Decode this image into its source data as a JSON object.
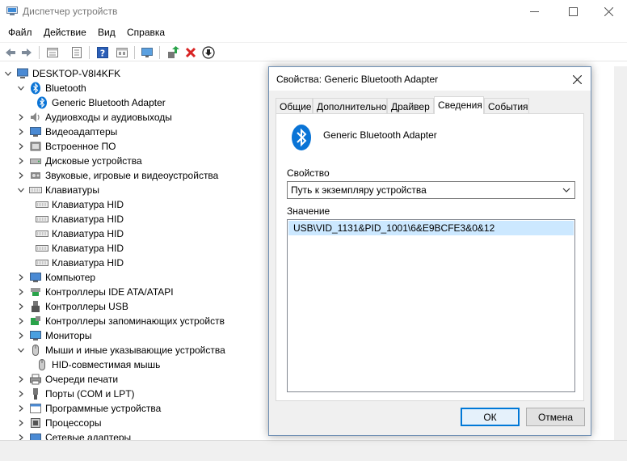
{
  "window": {
    "title": "Диспетчер устройств"
  },
  "menu": [
    {
      "label": "Файл"
    },
    {
      "label": "Действие"
    },
    {
      "label": "Вид"
    },
    {
      "label": "Справка"
    }
  ],
  "toolbar": {
    "icons": [
      "back-icon",
      "forward-icon",
      "properties-icon",
      "list-icon",
      "help-icon",
      "view-icon",
      "monitor-icon",
      "update-driver-icon",
      "uninstall-icon",
      "download-icon"
    ]
  },
  "tree": {
    "root": "DESKTOP-V8I4KFK",
    "items": [
      {
        "label": "Bluetooth",
        "level": 1,
        "expanded": true,
        "icon": "bluetooth-icon"
      },
      {
        "label": "Generic Bluetooth Adapter",
        "level": 2,
        "icon": "bluetooth-icon"
      },
      {
        "label": "Аудиовходы и аудиовыходы",
        "level": 1,
        "expanded": false,
        "icon": "speaker-icon"
      },
      {
        "label": "Видеоадаптеры",
        "level": 1,
        "expanded": false,
        "icon": "display-adapter-icon"
      },
      {
        "label": "Встроенное ПО",
        "level": 1,
        "expanded": false,
        "icon": "firmware-icon"
      },
      {
        "label": "Дисковые устройства",
        "level": 1,
        "expanded": false,
        "icon": "disk-icon"
      },
      {
        "label": "Звуковые, игровые и видеоустройства",
        "level": 1,
        "expanded": false,
        "icon": "sound-icon"
      },
      {
        "label": "Клавиатуры",
        "level": 1,
        "expanded": true,
        "icon": "keyboard-icon"
      },
      {
        "label": "Клавиатура HID",
        "level": 2,
        "icon": "keyboard-icon"
      },
      {
        "label": "Клавиатура HID",
        "level": 2,
        "icon": "keyboard-icon"
      },
      {
        "label": "Клавиатура HID",
        "level": 2,
        "icon": "keyboard-icon"
      },
      {
        "label": "Клавиатура HID",
        "level": 2,
        "icon": "keyboard-icon"
      },
      {
        "label": "Клавиатура HID",
        "level": 2,
        "icon": "keyboard-icon"
      },
      {
        "label": "Компьютер",
        "level": 1,
        "expanded": false,
        "icon": "computer-icon"
      },
      {
        "label": "Контроллеры IDE ATA/ATAPI",
        "level": 1,
        "expanded": false,
        "icon": "ide-icon"
      },
      {
        "label": "Контроллеры USB",
        "level": 1,
        "expanded": false,
        "icon": "usb-icon"
      },
      {
        "label": "Контроллеры запоминающих устройств",
        "level": 1,
        "expanded": false,
        "icon": "storage-controller-icon"
      },
      {
        "label": "Мониторы",
        "level": 1,
        "expanded": false,
        "icon": "monitor-icon"
      },
      {
        "label": "Мыши и иные указывающие устройства",
        "level": 1,
        "expanded": true,
        "icon": "mouse-icon"
      },
      {
        "label": "HID-совместимая мышь",
        "level": 2,
        "icon": "mouse-icon"
      },
      {
        "label": "Очереди печати",
        "level": 1,
        "expanded": false,
        "icon": "printer-icon"
      },
      {
        "label": "Порты (COM и LPT)",
        "level": 1,
        "expanded": false,
        "icon": "port-icon"
      },
      {
        "label": "Программные устройства",
        "level": 1,
        "expanded": false,
        "icon": "software-device-icon"
      },
      {
        "label": "Процессоры",
        "level": 1,
        "expanded": false,
        "icon": "cpu-icon"
      },
      {
        "label": "Сетевые адаптеры",
        "level": 1,
        "expanded": false,
        "icon": "network-icon"
      }
    ]
  },
  "dialog": {
    "title": "Свойства: Generic Bluetooth Adapter",
    "tabs": [
      {
        "label": "Общие",
        "active": false
      },
      {
        "label": "Дополнительно",
        "active": false
      },
      {
        "label": "Драйвер",
        "active": false
      },
      {
        "label": "Сведения",
        "active": true
      },
      {
        "label": "События",
        "active": false
      }
    ],
    "device_name": "Generic Bluetooth Adapter",
    "property_label": "Свойство",
    "property_value": "Путь к экземпляру устройства",
    "value_label": "Значение",
    "values": [
      "USB\\VID_1131&PID_1001\\6&E9BCFE3&0&12"
    ],
    "ok_label": "ОК",
    "cancel_label": "Отмена"
  },
  "colors": {
    "accent": "#0078d7",
    "bluetooth": "#0a74d6",
    "selection": "#cce8ff"
  }
}
